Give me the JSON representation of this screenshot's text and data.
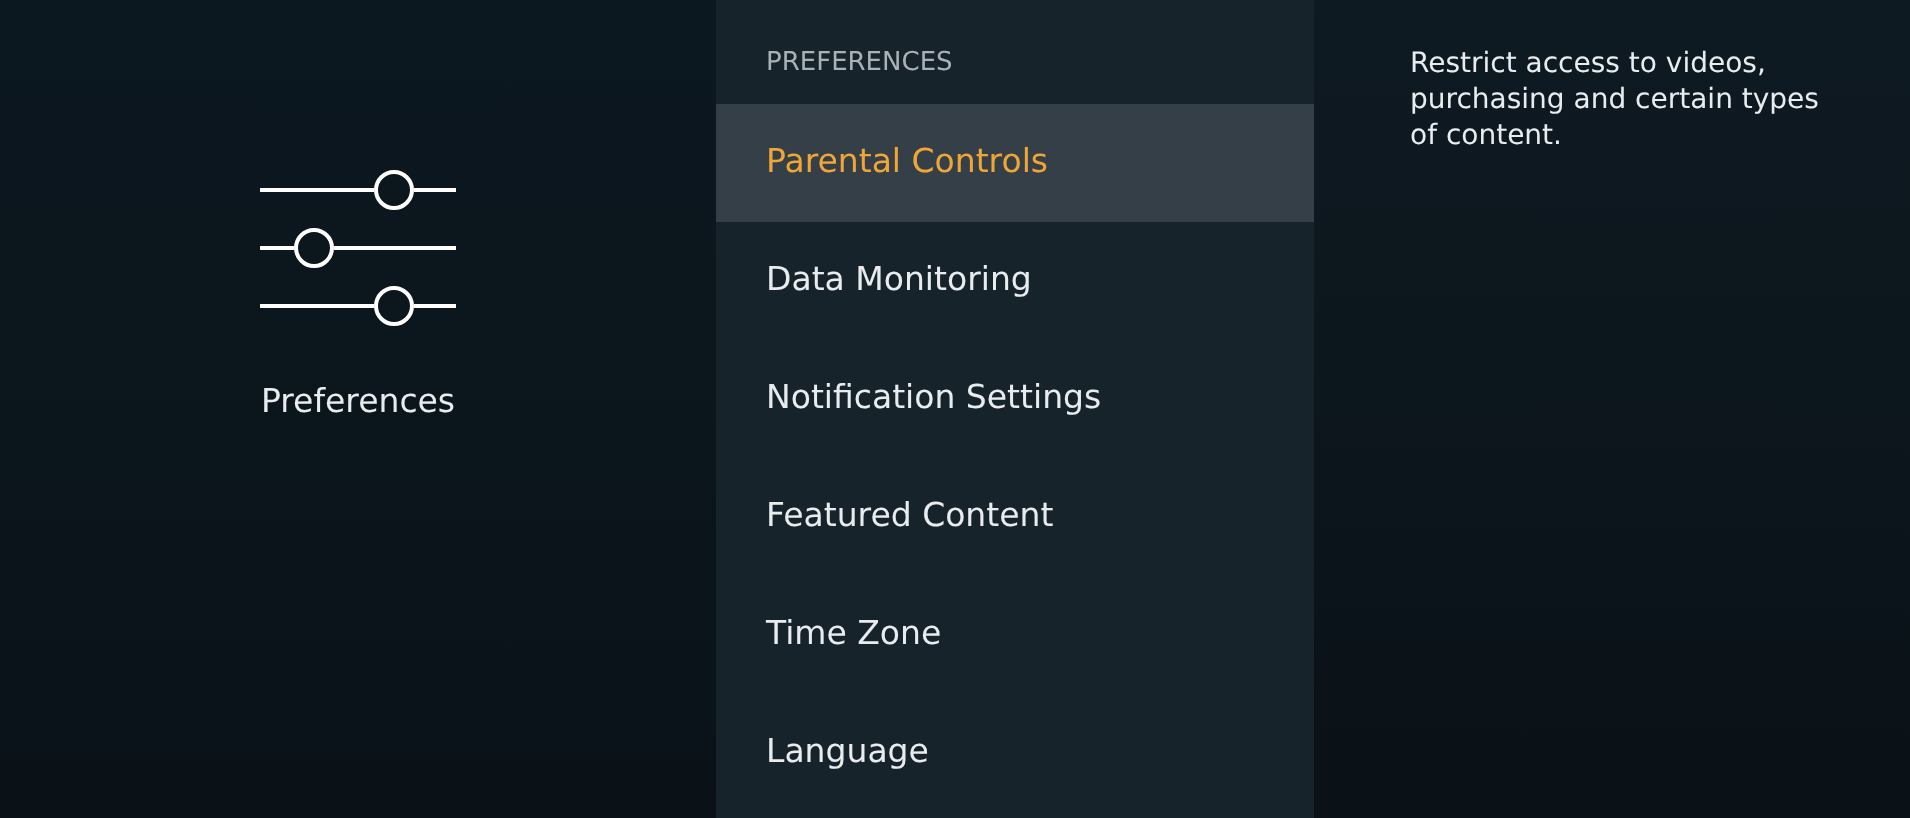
{
  "category": {
    "label": "Preferences"
  },
  "menu": {
    "header": "PREFERENCES",
    "items": [
      {
        "label": "Parental Controls",
        "selected": true
      },
      {
        "label": "Data Monitoring",
        "selected": false
      },
      {
        "label": "Notification Settings",
        "selected": false
      },
      {
        "label": "Featured Content",
        "selected": false
      },
      {
        "label": "Time Zone",
        "selected": false
      },
      {
        "label": "Language",
        "selected": false
      }
    ]
  },
  "description": "Restrict access to videos, purchasing and certain types of content."
}
